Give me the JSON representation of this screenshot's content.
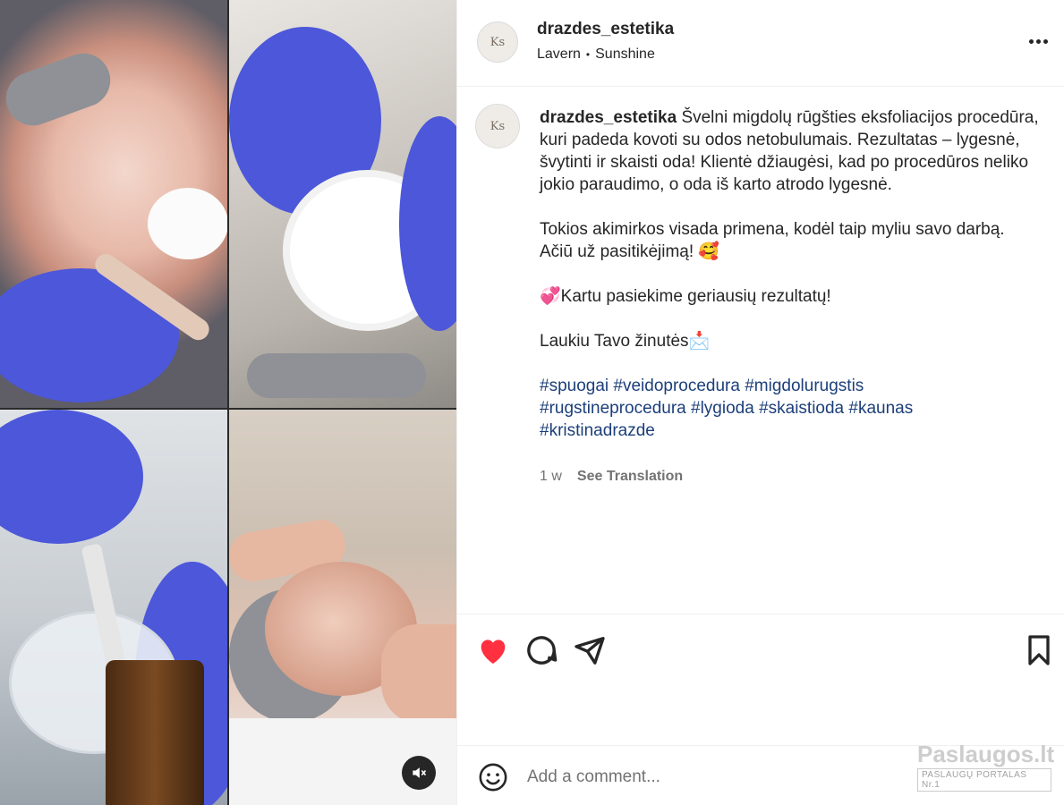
{
  "post": {
    "username": "drazdes_estetika",
    "location_parts": [
      "Lavern",
      "Sunshine"
    ],
    "location_separator": "•",
    "avatar_text": "Ks"
  },
  "caption": {
    "username": "drazdes_estetika",
    "paragraph1": "Švelni migdolų rūgšties eksfoliacijos procedūra, kuri padeda kovoti su odos netobulumais. Rezultatas – lygesnė, švytinti ir skaisti oda! Klientė džiaugėsi, kad po procedūros neliko jokio paraudimo, o oda iš karto atrodo lygesnė.",
    "paragraph2": "Tokios akimirkos visada primena, kodėl taip myliu savo darbą. Ačiū už pasitikėjimą! 🥰",
    "paragraph3": "💞Kartu pasiekime geriausių rezultatų!",
    "paragraph4": "Laukiu Tavo žinutės📩",
    "hashtags": [
      "#spuogai",
      "#veidoprocedura",
      "#migdolurugstis",
      "#rugstineprocedura",
      "#lygioda",
      "#skaistioda",
      "#kaunas",
      "#kristinadrazde"
    ],
    "time_ago": "1 w",
    "see_translation": "See Translation"
  },
  "actions": {
    "like_color": "#ff3040",
    "icons": [
      "heart-icon",
      "comment-icon",
      "share-icon",
      "bookmark-icon"
    ]
  },
  "comment": {
    "placeholder": "Add a comment...",
    "emoji_icon": "smiley-icon"
  },
  "watermark": {
    "title": "Paslaugos.lt",
    "subtitle": "PASLAUGŲ PORTALAS",
    "badge": "Nr.1"
  }
}
